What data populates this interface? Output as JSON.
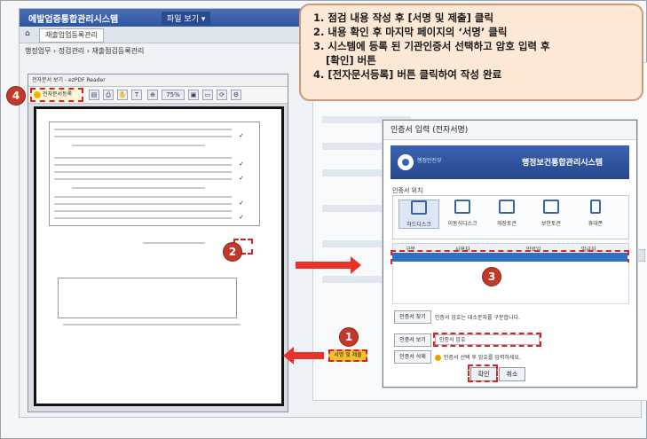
{
  "app": {
    "title": "에발업증통합관리시스템",
    "window_badge": "파일 보기 ▾",
    "tab_label": "재출업업등록관리",
    "breadcrumb": "행정업무 › 정검관리 › 재출점검등록관리"
  },
  "callout": {
    "steps": [
      "1. 점검 내용 작성 후 [서명 및 제출] 클릭",
      "2. 내용 확인 후 마지막 페이지의 ‘서명’ 클릭",
      "3. 시스템에 등록 된 기관인증서 선택하고 암호 입력 후",
      "[확인] 버튼",
      "4. [전자문서등록] 버튼 클릭하여 작성 완료"
    ]
  },
  "markers": {
    "one": "1",
    "two": "2",
    "three": "3",
    "four": "4"
  },
  "pdf": {
    "title": "전자문서 보기 - ezPDF Reader",
    "sign_button": "전자문서등록",
    "zoom": "75%"
  },
  "cert_dialog": {
    "title": "인증서 입력 (전자서명)",
    "banner_org": "행정안전부",
    "banner_system": "행정보건통합관리시스템",
    "location_label": "인증서 위치",
    "locations": [
      "하드디스크",
      "이동식디스크",
      "저장토큰",
      "보안토큰",
      "휴대폰"
    ],
    "grid_headers": [
      "구분",
      "사용자",
      "만료일",
      "발급자"
    ],
    "selected_row": [
      "",
      "",
      "",
      ""
    ],
    "actions": [
      {
        "label": "인증서 찾기",
        "note": "인증서 암호는 대소문자를 구분합니다."
      },
      {
        "label": "인증서 보기",
        "note": ""
      },
      {
        "label": "인증서 삭제",
        "note": "인증서 선택 후 암호를 입력하세요."
      }
    ],
    "password_value": "인증서 암호",
    "ok_label": "확인",
    "cancel_label": "취소"
  },
  "submit_button": "서명 및 제출",
  "colors": {
    "accent_red": "#e02020",
    "brand_blue": "#3b63b0",
    "callout_bg": "#fde8d6"
  }
}
